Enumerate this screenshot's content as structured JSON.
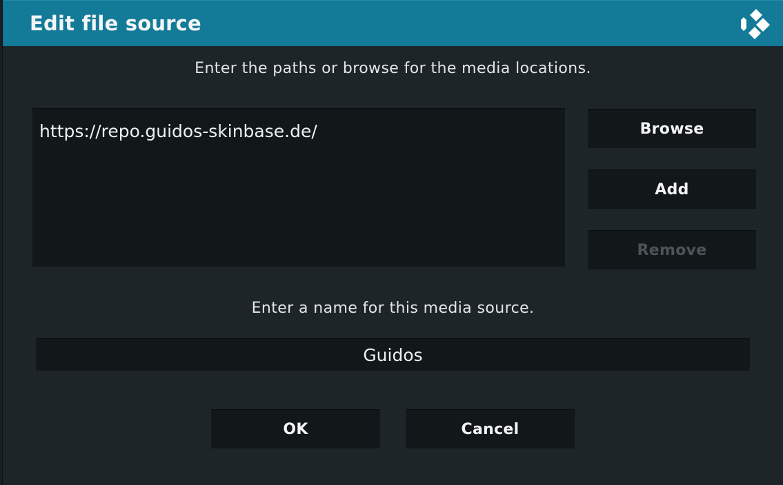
{
  "dialog": {
    "title": "Edit file source",
    "logo_icon": "kodi-logo-icon",
    "header_color": "#137a98"
  },
  "paths_section": {
    "instruction": "Enter the paths or browse for the media locations.",
    "paths": [
      "https://repo.guidos-skinbase.de/"
    ]
  },
  "path_buttons": {
    "browse_label": "Browse",
    "add_label": "Add",
    "remove_label": "Remove"
  },
  "name_section": {
    "instruction": "Enter a name for this media source.",
    "value": "Guidos"
  },
  "actions": {
    "ok_label": "OK",
    "cancel_label": "Cancel"
  }
}
